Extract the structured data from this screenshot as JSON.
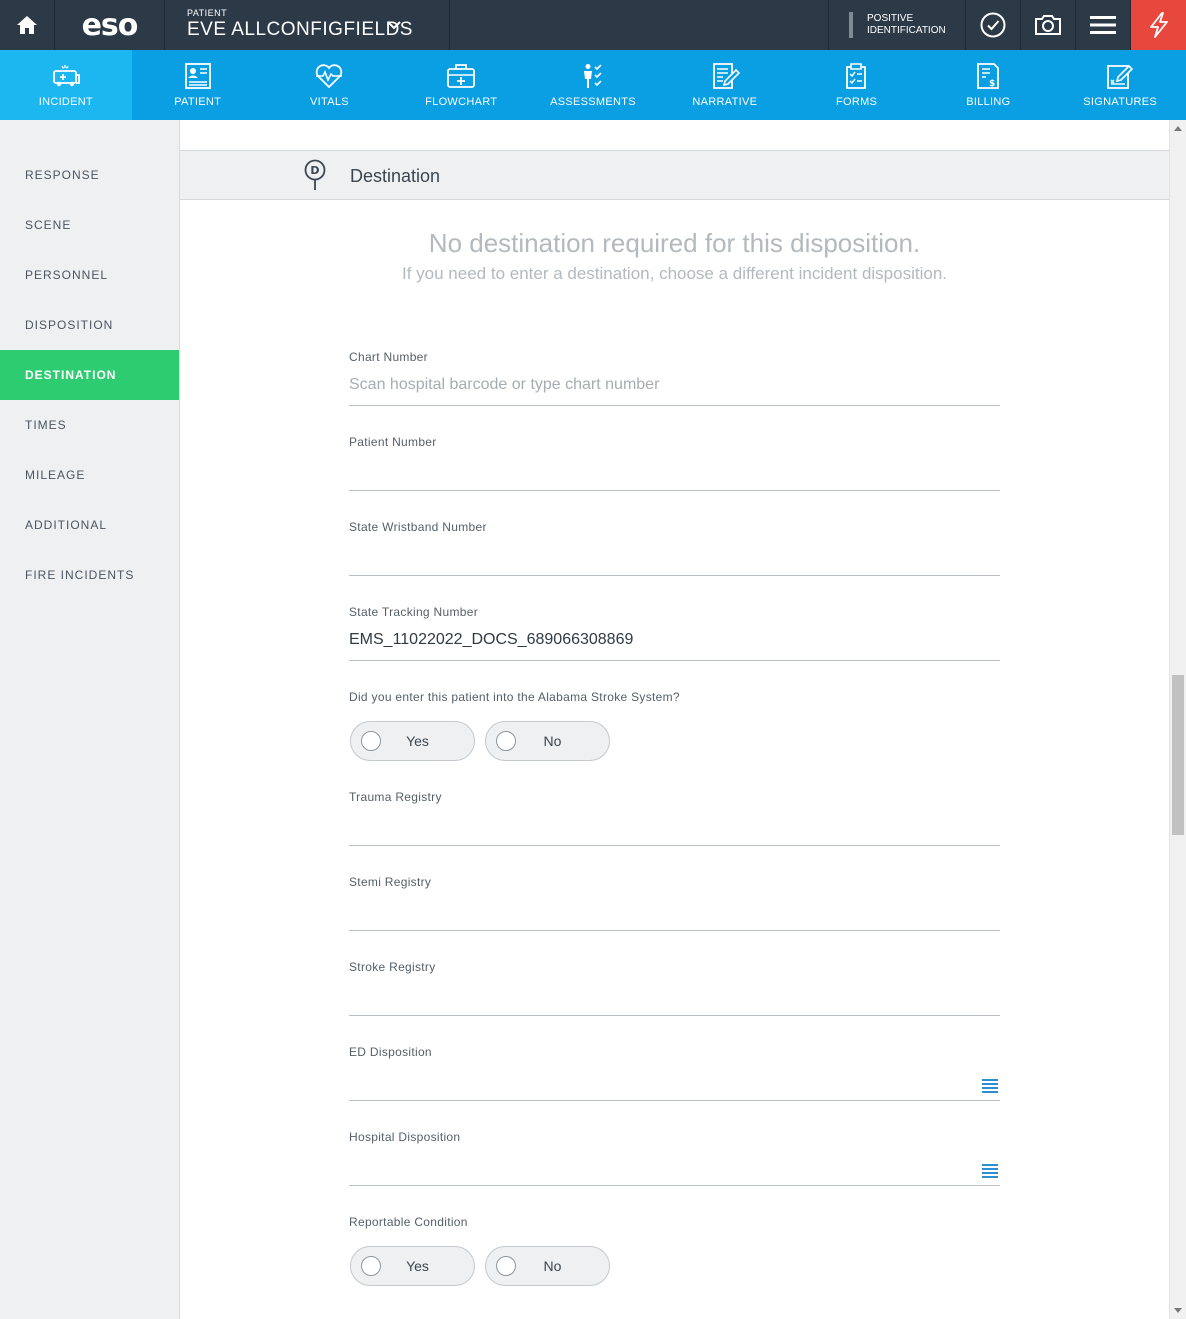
{
  "topbar": {
    "logo": "eso",
    "patient_label": "PATIENT",
    "patient_name": "EVE ALLCONFIGFIELDS",
    "positive_id_line1": "POSITIVE",
    "positive_id_line2": "IDENTIFICATION"
  },
  "nav": [
    {
      "label": "INCIDENT",
      "icon": "ambulance-icon",
      "active": true
    },
    {
      "label": "PATIENT",
      "icon": "patient-card-icon"
    },
    {
      "label": "VITALS",
      "icon": "heartbeat-icon"
    },
    {
      "label": "FLOWCHART",
      "icon": "medkit-icon"
    },
    {
      "label": "ASSESSMENTS",
      "icon": "body-check-icon"
    },
    {
      "label": "NARRATIVE",
      "icon": "document-pen-icon"
    },
    {
      "label": "FORMS",
      "icon": "checklist-icon"
    },
    {
      "label": "BILLING",
      "icon": "invoice-icon"
    },
    {
      "label": "SIGNATURES",
      "icon": "signature-icon"
    }
  ],
  "sidebar": [
    {
      "label": "RESPONSE"
    },
    {
      "label": "SCENE"
    },
    {
      "label": "PERSONNEL"
    },
    {
      "label": "DISPOSITION"
    },
    {
      "label": "DESTINATION",
      "active": true
    },
    {
      "label": "TIMES"
    },
    {
      "label": "MILEAGE"
    },
    {
      "label": "ADDITIONAL"
    },
    {
      "label": "FIRE INCIDENTS"
    }
  ],
  "section": {
    "title": "Destination",
    "pin_letter": "D",
    "message_main": "No destination required for this disposition.",
    "message_sub": "If you need to enter a destination, choose a different incident disposition."
  },
  "fields": {
    "chart_number": {
      "label": "Chart Number",
      "placeholder": "Scan hospital barcode or type chart number",
      "value": ""
    },
    "patient_number": {
      "label": "Patient Number",
      "value": ""
    },
    "state_wristband": {
      "label": "State Wristband Number",
      "value": ""
    },
    "state_tracking": {
      "label": "State Tracking Number",
      "value": "EMS_11022022_DOCS_689066308869"
    },
    "stroke_system": {
      "label": "Did you enter this patient into the Alabama Stroke System?",
      "yes": "Yes",
      "no": "No"
    },
    "trauma_registry": {
      "label": "Trauma Registry",
      "value": ""
    },
    "stemi_registry": {
      "label": "Stemi Registry",
      "value": ""
    },
    "stroke_registry": {
      "label": "Stroke Registry",
      "value": ""
    },
    "ed_disposition": {
      "label": "ED Disposition",
      "value": ""
    },
    "hospital_disposition": {
      "label": "Hospital Disposition",
      "value": ""
    },
    "reportable_condition": {
      "label": "Reportable Condition",
      "yes": "Yes",
      "no": "No"
    }
  },
  "colors": {
    "topbar": "#2c3a47",
    "nav": "#0a9ee2",
    "nav_active": "#1cb6f0",
    "sidebar_active": "#2ecc71",
    "alert": "#e8473d"
  }
}
